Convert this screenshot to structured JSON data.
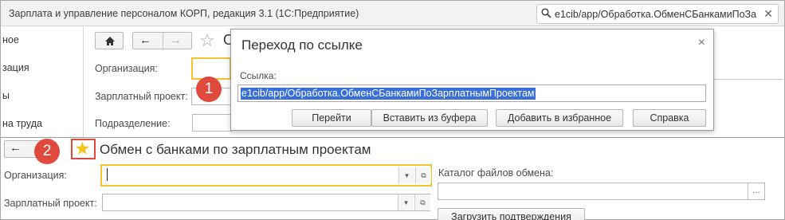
{
  "app": {
    "title": "Зарплата и управление персоналом КОРП, редакция 3.1  (1С:Предприятие)",
    "url": "e1cib/app/Обработка.ОбменСБанкамиПоЗа",
    "clear_icon": "✕"
  },
  "leftnav": {
    "items": [
      {
        "label": "ное"
      },
      {
        "label": "зация"
      },
      {
        "label": "ы"
      },
      {
        "label": "на труда"
      }
    ]
  },
  "bg_form": {
    "title_fragment": "О",
    "labels": {
      "organization": "Организация:",
      "salary_project": "Зарплатный проект:",
      "department": "Подразделение:"
    }
  },
  "dialog": {
    "title": "Переход по ссылке",
    "close": "×",
    "link_label": "Ссылка:",
    "link_value": "e1cib/app/Обработка.ОбменСБанкамиПоЗарплатнымПроектам",
    "buttons": {
      "go": "Перейти",
      "paste": "Вставить из буфера",
      "favorite": "Добавить в избранное",
      "help": "Справка"
    }
  },
  "badges": {
    "one": "1",
    "two": "2"
  },
  "form": {
    "title": "Обмен с банками по зарплатным проектам",
    "organization_label": "Организация:",
    "salary_project_label": "Зарплатный проект:",
    "catalog_label": "Каталог файлов обмена:",
    "dots": "...",
    "load_button": "Загрузить подтверждения"
  },
  "colors": {
    "badge": "#e04a3c",
    "star": "#f5c518",
    "focus_border": "#f2c230",
    "selection": "#3a6fd8"
  }
}
